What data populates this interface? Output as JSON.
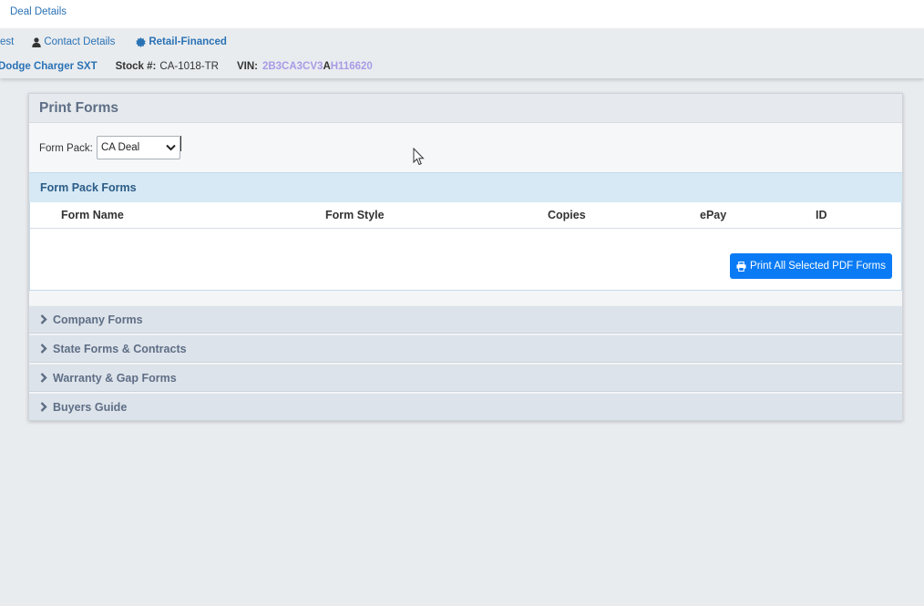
{
  "topbar": {
    "breadcrumb": "Deal Details"
  },
  "nav": {
    "partial_item": "est",
    "contact_details": "Contact Details",
    "deal_type": "Retail-Financed"
  },
  "vehicle": {
    "name": "Dodge Charger SXT",
    "stock_label": "Stock #:",
    "stock_value": "CA-1018-TR",
    "vin_label": "VIN:",
    "vin_part1": "2B3CA3CV3",
    "vin_part2": "A",
    "vin_part3": "H116620"
  },
  "print_forms": {
    "title": "Print Forms",
    "form_pack_label": "Form Pack:",
    "form_pack_selected": "CA Deal",
    "form_pack_forms_title": "Form Pack Forms",
    "columns": [
      "Form Name",
      "Form Style",
      "Copies",
      "ePay",
      "ID"
    ],
    "print_button": "Print All Selected PDF Forms",
    "sections": [
      "Company Forms",
      "State Forms & Contracts",
      "Warranty & Gap Forms",
      "Buyers Guide"
    ]
  },
  "colors": {
    "link": "#2a72b5",
    "primary_button": "#0a7bf4",
    "section_text": "#5e6e86",
    "vin_highlight": "#a79be6"
  }
}
